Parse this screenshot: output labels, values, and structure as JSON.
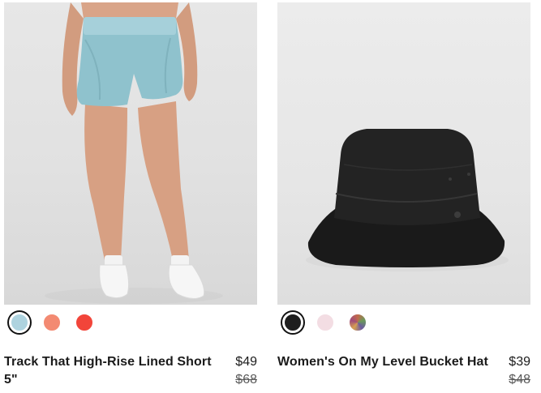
{
  "products": [
    {
      "name": "Track That High-Rise Lined Short 5\"",
      "price": "$49",
      "original_price": "$68",
      "image_subject": "shorts",
      "swatches": [
        {
          "color": "#aed3df",
          "selected": true
        },
        {
          "color": "#f38a72",
          "selected": false
        },
        {
          "color": "#f2453a",
          "selected": false
        }
      ]
    },
    {
      "name": "Women's On My Level Bucket Hat",
      "price": "$39",
      "original_price": "$48",
      "image_subject": "bucket-hat",
      "swatches": [
        {
          "color": "#1e1e1e",
          "selected": true
        },
        {
          "color": "#f3dde3",
          "selected": false
        },
        {
          "color": "#9a6a86",
          "selected": false
        }
      ]
    }
  ]
}
